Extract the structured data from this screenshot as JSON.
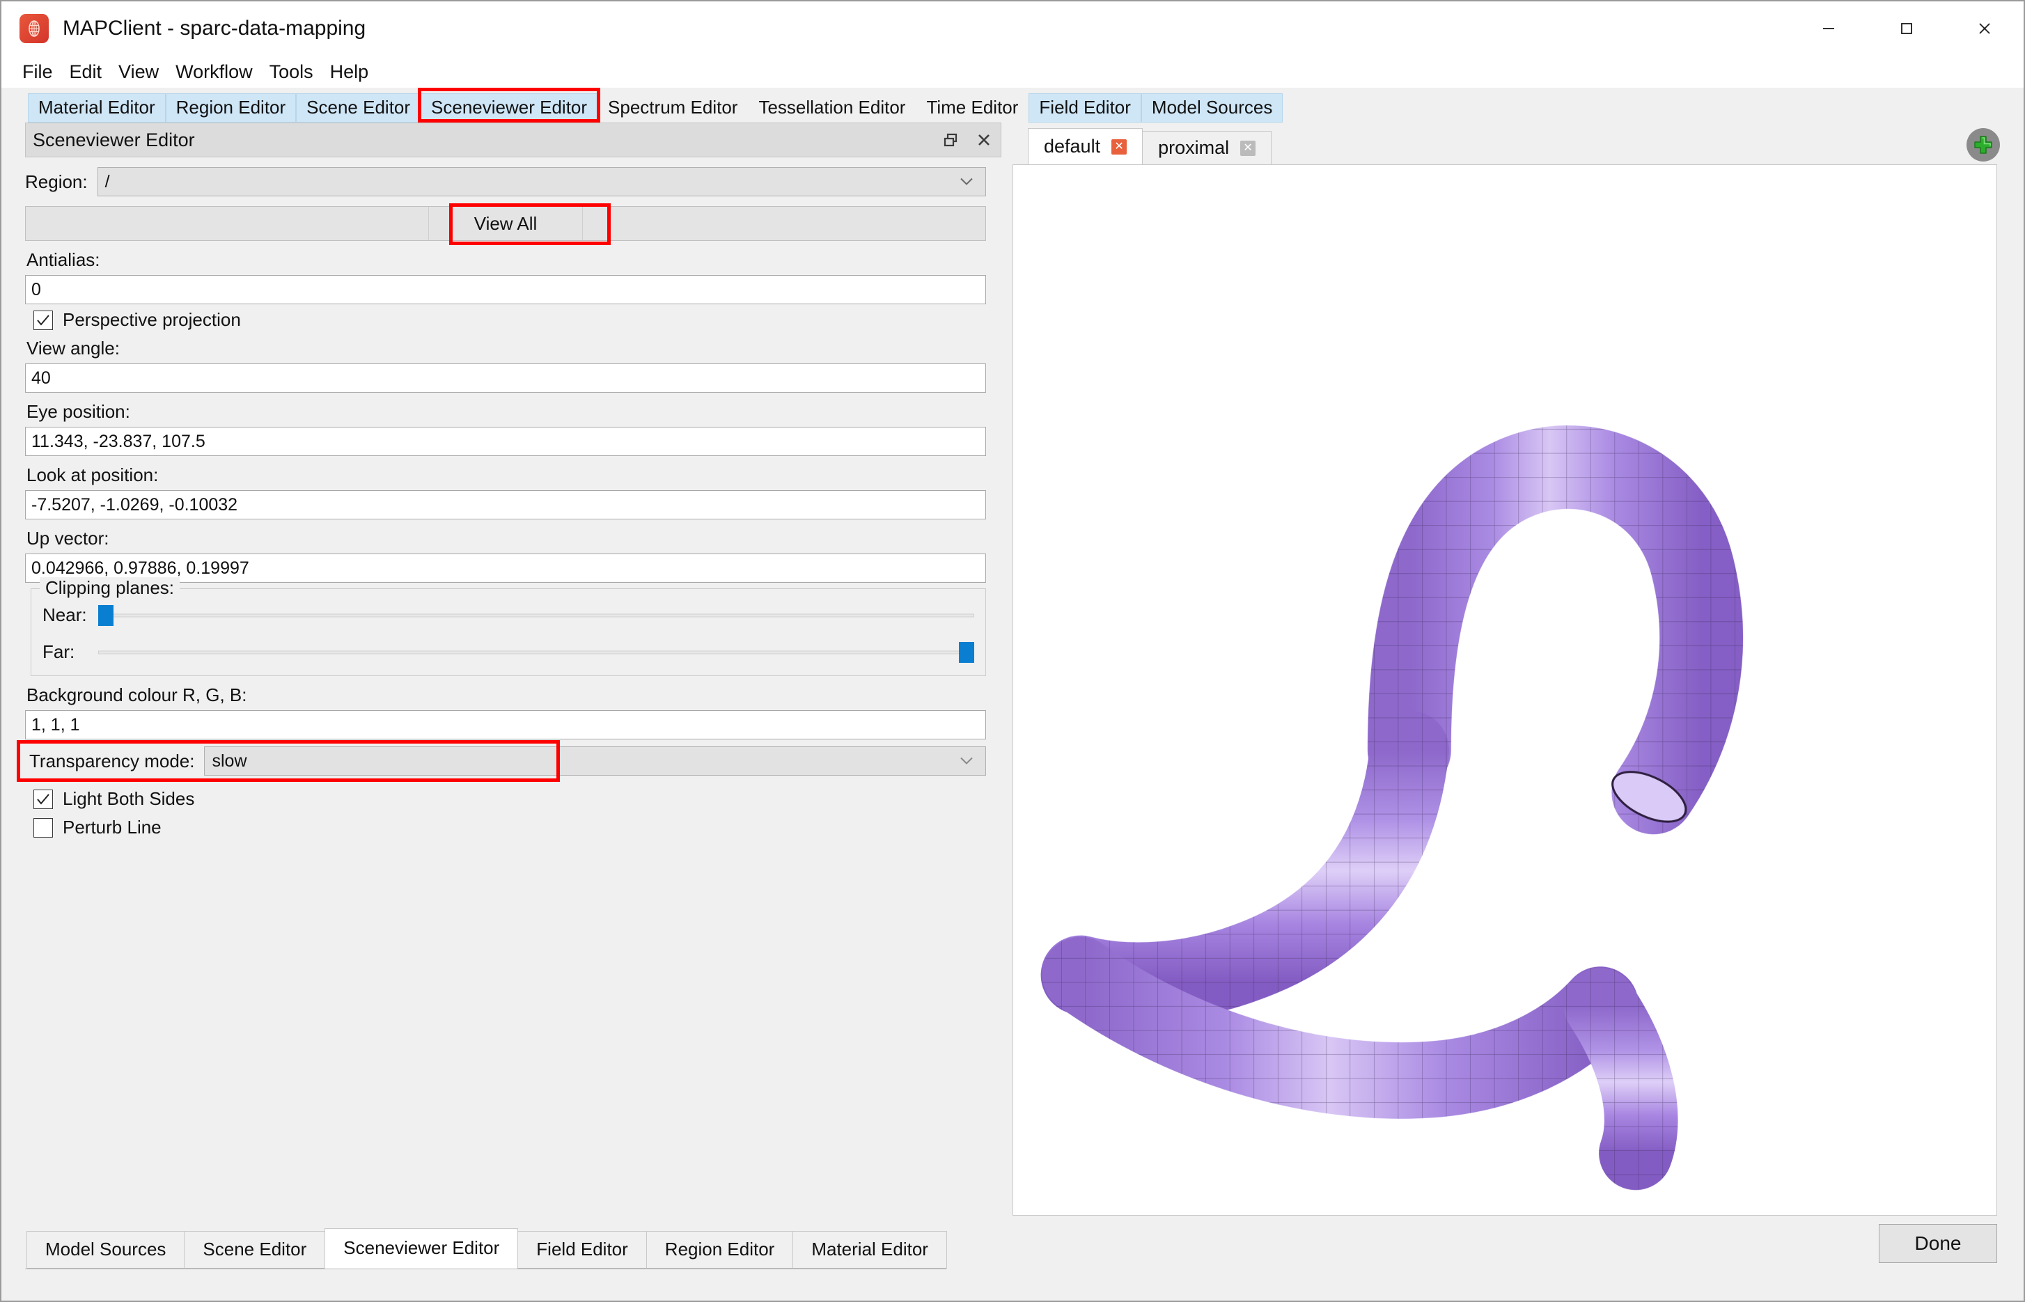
{
  "window": {
    "title": "MAPClient - sparc-data-mapping",
    "icon": "globe-mesh-icon",
    "controls": {
      "minimize": "minimize-icon",
      "maximize": "maximize-icon",
      "close": "close-icon"
    }
  },
  "menubar": {
    "items": [
      "File",
      "Edit",
      "View",
      "Workflow",
      "Tools",
      "Help"
    ]
  },
  "top_tabs": [
    {
      "label": "Material Editor",
      "state": "highlighted"
    },
    {
      "label": "Region Editor",
      "state": "highlighted"
    },
    {
      "label": "Scene Editor",
      "state": "highlighted"
    },
    {
      "label": "Sceneviewer Editor",
      "state": "selected"
    },
    {
      "label": "Spectrum Editor",
      "state": "normal"
    },
    {
      "label": "Tessellation Editor",
      "state": "normal"
    },
    {
      "label": "Time Editor",
      "state": "normal"
    },
    {
      "label": "Field Editor",
      "state": "highlighted"
    },
    {
      "label": "Model Sources",
      "state": "highlighted"
    }
  ],
  "panel": {
    "title": "Sceneviewer Editor",
    "float_icon": "restore-window-icon",
    "close_icon": "close-icon"
  },
  "form": {
    "region_label": "Region:",
    "region_value": "/",
    "view_all_label": "View All",
    "antialias_label": "Antialias:",
    "antialias_value": "0",
    "perspective_label": "Perspective projection",
    "perspective_checked": true,
    "view_angle_label": "View angle:",
    "view_angle_value": "40",
    "eye_position_label": "Eye position:",
    "eye_position_value": "11.343, -23.837, 107.5",
    "look_at_label": "Look at position:",
    "look_at_value": "-7.5207, -1.0269, -0.10032",
    "up_vector_label": "Up vector:",
    "up_vector_value": "0.042966, 0.97886, 0.19997",
    "clipping_group_label": "Clipping planes:",
    "near_label": "Near:",
    "near_percent": 0,
    "far_label": "Far:",
    "far_percent": 100,
    "background_label": "Background colour R, G, B:",
    "background_value": "1, 1, 1",
    "transparency_label": "Transparency mode:",
    "transparency_value": "slow",
    "light_both_sides_label": "Light Both Sides",
    "light_both_sides_checked": true,
    "perturb_line_label": "Perturb Line",
    "perturb_line_checked": false
  },
  "viewer": {
    "tabs": [
      {
        "label": "default",
        "active": true,
        "close_icon": "close-tab-icon"
      },
      {
        "label": "proximal",
        "active": false,
        "close_icon": "close-tab-icon"
      }
    ],
    "add_button_icon": "plus-icon",
    "model_description": "purple tubular mesh model",
    "model_color": "#9b72d9",
    "background_color": "#ffffff"
  },
  "bottom_tabs": [
    {
      "label": "Model Sources",
      "active": false
    },
    {
      "label": "Scene Editor",
      "active": false
    },
    {
      "label": "Sceneviewer Editor",
      "active": true
    },
    {
      "label": "Field Editor",
      "active": false
    },
    {
      "label": "Region Editor",
      "active": false
    },
    {
      "label": "Material Editor",
      "active": false
    }
  ],
  "done_button": "Done",
  "highlight_color": "#ff0000"
}
